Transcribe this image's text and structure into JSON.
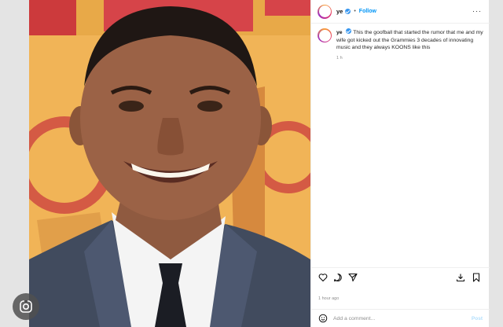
{
  "post": {
    "username": "ye",
    "dot": "•",
    "follow_label": "Follow",
    "more_label": "···",
    "caption_text": "This the goofball that started the rumor that me and my wife got kicked out the Grammies 3 decades of innovating music and they always KOONS like this",
    "caption_age": "1 h",
    "posted_time": "1 hour ago",
    "comment_placeholder": "Add a comment...",
    "post_button_label": "Post"
  },
  "icons": [
    "heart-icon",
    "comment-icon",
    "share-icon",
    "save-icon",
    "emoji-icon",
    "lens-icon",
    "verified-icon"
  ],
  "colors": {
    "accent": "#0095f6",
    "verified": "#3897f0",
    "backdrop": "#f1b457",
    "suit": "#414b5e"
  }
}
